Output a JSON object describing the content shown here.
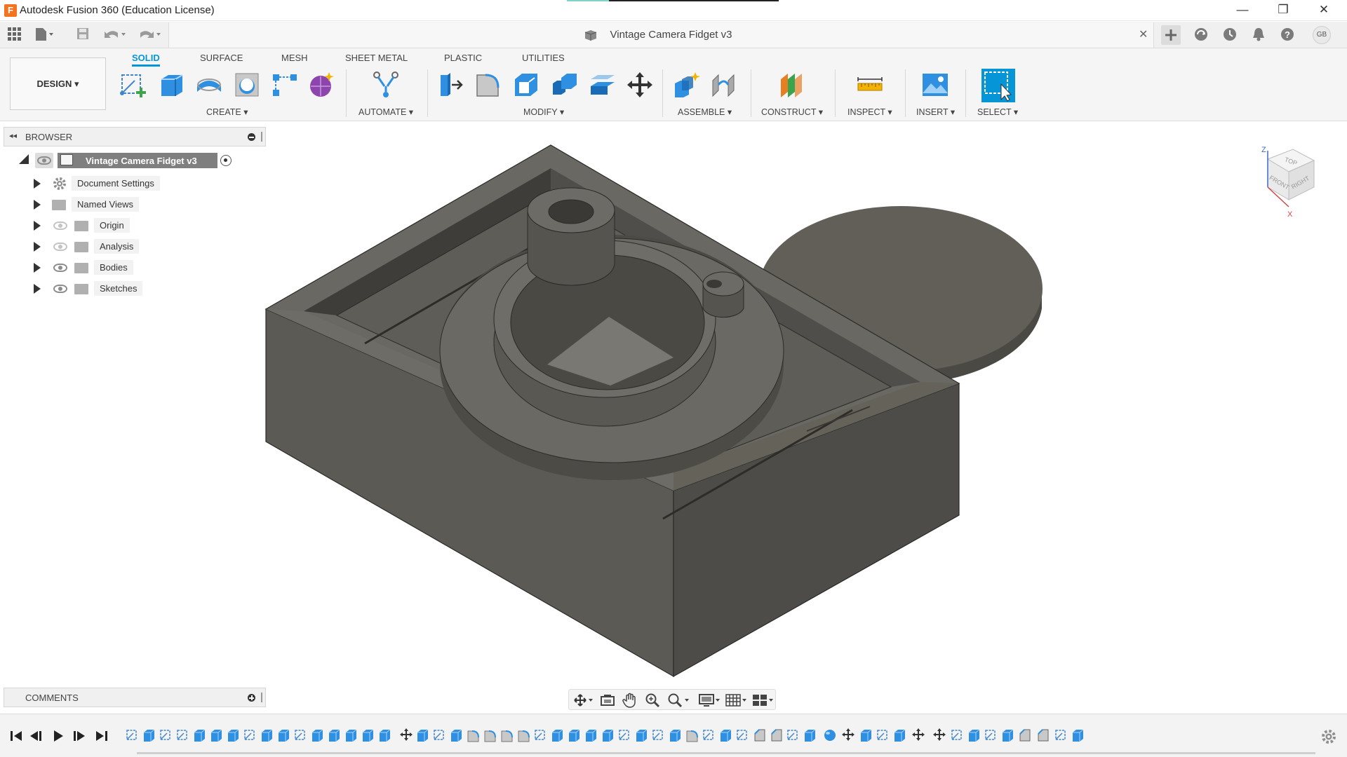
{
  "window": {
    "title": "Autodesk Fusion 360 (Education License)",
    "logo_letter": "F",
    "minimize": "—",
    "restore": "❐",
    "close": "✕"
  },
  "quick_access": {
    "user_initials": "GB",
    "doc_title": "Vintage Camera Fidget v3",
    "close_tab": "✕"
  },
  "ribbon": {
    "workspace": "DESIGN ▾",
    "tabs": [
      "SOLID",
      "SURFACE",
      "MESH",
      "SHEET METAL",
      "PLASTIC",
      "UTILITIES"
    ],
    "active_tab": "SOLID",
    "groups": [
      "CREATE ▾",
      "AUTOMATE ▾",
      "MODIFY ▾",
      "ASSEMBLE ▾",
      "CONSTRUCT ▾",
      "INSPECT ▾",
      "INSERT ▾",
      "SELECT ▾"
    ]
  },
  "browser": {
    "title": "BROWSER",
    "root": "Vintage Camera Fidget v3",
    "items": [
      {
        "label": "Document Settings",
        "icon": "gear-icon",
        "eye": "none"
      },
      {
        "label": "Named Views",
        "icon": "folder-icon",
        "eye": "none"
      },
      {
        "label": "Origin",
        "icon": "folder-icon",
        "eye": "hidden"
      },
      {
        "label": "Analysis",
        "icon": "folder-icon",
        "eye": "hidden"
      },
      {
        "label": "Bodies",
        "icon": "folder-icon",
        "eye": "visible"
      },
      {
        "label": "Sketches",
        "icon": "folder-icon",
        "eye": "visible"
      }
    ]
  },
  "comments": {
    "title": "COMMENTS"
  },
  "viewcube": {
    "top": "TOP",
    "front": "FRONT",
    "right": "RIGHT",
    "z": "Z",
    "x": "X"
  },
  "colors": {
    "accent": "#0696d7",
    "model": "#5f5e58",
    "orange": "#f37321"
  }
}
